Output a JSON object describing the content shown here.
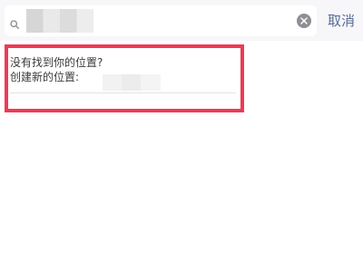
{
  "search": {
    "value": "",
    "placeholder": ""
  },
  "header": {
    "cancel_label": "取消"
  },
  "suggestion": {
    "prompt": "没有找到你的位置?",
    "create_label": "创建新的位置:"
  },
  "icons": {
    "search": "search-icon",
    "clear": "clear-icon"
  },
  "colors": {
    "highlight_border": "#ee3a55",
    "cancel_text": "#576b95",
    "top_bar": "#f7f7f9"
  }
}
